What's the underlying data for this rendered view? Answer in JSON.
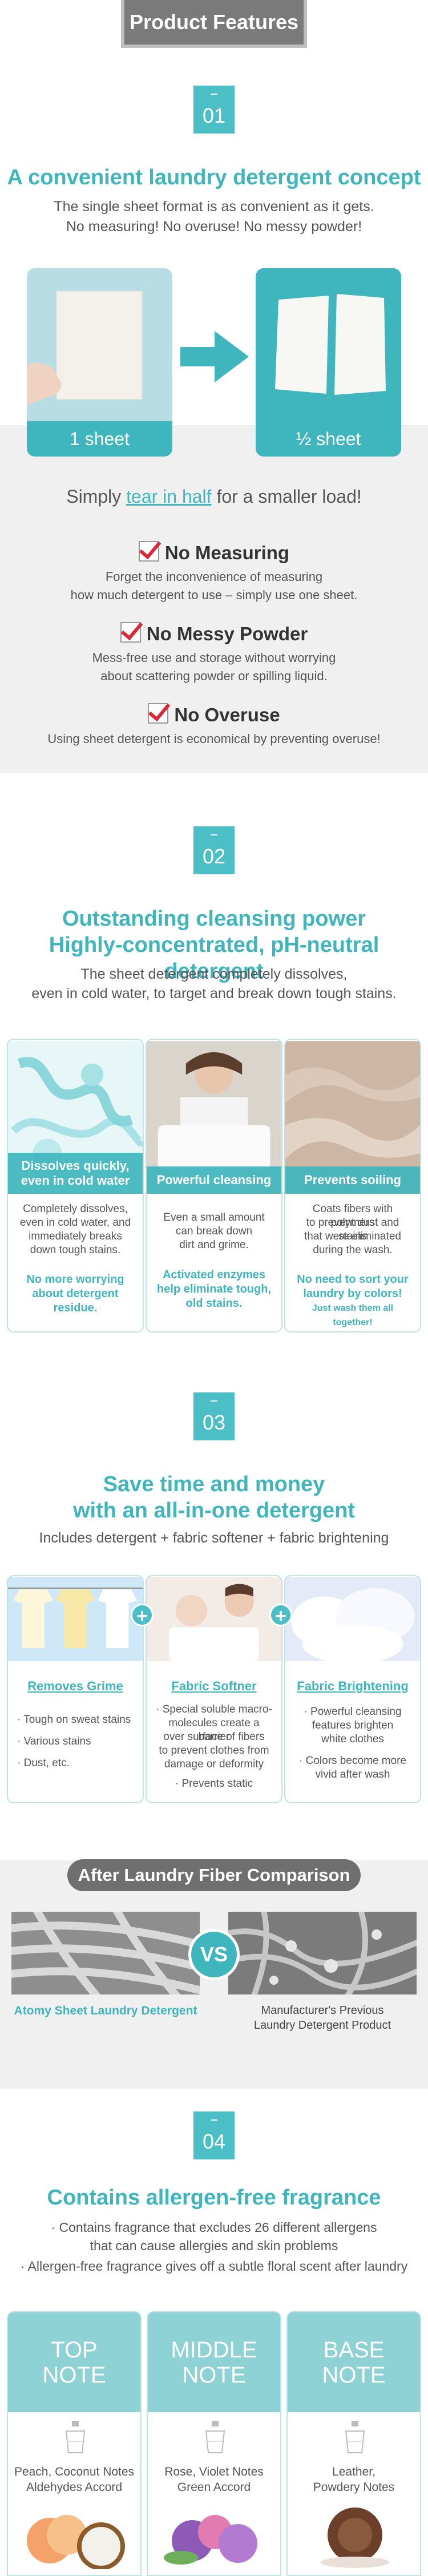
{
  "header": {
    "title": "Product Features"
  },
  "s1": {
    "num": "01",
    "title": "A convenient laundry detergent concept",
    "sub1": "The single sheet format is as convenient as it gets.",
    "sub2": "No measuring! No overuse! No messy powder!",
    "sheet1": "1 sheet",
    "sheet2": "½ sheet",
    "tear_pre": "Simply ",
    "tear_hl": "tear in half",
    "tear_post": " for a smaller load!",
    "features": [
      {
        "title": "No Measuring",
        "d1": "Forget the inconvenience of measuring",
        "d2": "how much detergent to use – simply use one sheet."
      },
      {
        "title": "No Messy Powder",
        "d1": "Mess-free use and storage without worrying",
        "d2": "about scattering powder or spilling liquid."
      },
      {
        "title": "No Overuse",
        "d1": "Using sheet detergent is economical by preventing overuse!",
        "d2": ""
      }
    ]
  },
  "s2": {
    "num": "02",
    "title1": "Outstanding cleansing power",
    "title2": "Highly-concentrated, pH-neutral detergent",
    "sub1": "The sheet detergent completely dissolves,",
    "sub2": "even in cold water, to target and break down tough stains.",
    "cards": [
      {
        "cap": "Dissolves quickly, even in cold water",
        "t1": "Completely dissolves,",
        "t2": "even in cold water, and",
        "t3": "immediately breaks",
        "t4": "down tough stains.",
        "h1": "No more worrying",
        "h2": "about detergent",
        "h3": "residue.",
        "h4": ""
      },
      {
        "cap": "Powerful cleansing",
        "t1": "Even a small amount",
        "t2": "can break down",
        "t3": "dirt and grime.",
        "t4": "",
        "h1": "Activated enzymes",
        "h2": "help eliminate tough,",
        "h3": "old stains.",
        "h4": ""
      },
      {
        "cap": "Prevents soiling",
        "t1": "Coats fibers with polymers",
        "t2": "to prevent dust and stains",
        "t3": "that were eliminated",
        "t4": "during the wash.",
        "h1": "No need to sort your",
        "h2": "laundry by colors!",
        "h3": "Just wash them all together!",
        "h4": ""
      }
    ]
  },
  "s3": {
    "num": "03",
    "title1": "Save time and money",
    "title2": "with an all-in-one detergent",
    "sub": "Includes detergent + fabric softener + fabric brightening",
    "cards": [
      {
        "title": "Removes Grime",
        "items": [
          "· Tough on sweat stains",
          "· Various stains",
          "· Dust, etc."
        ]
      },
      {
        "title": "Fabric Softner",
        "items": [
          "· Special soluble macro-",
          "molecules create a barrier",
          "over surface of fibers",
          "to prevent clothes from",
          "damage or deformity",
          "· Prevents static"
        ]
      },
      {
        "title": "Fabric Brightening",
        "items": [
          "· Powerful cleansing",
          "features brighten",
          "white clothes",
          "· Colors become more",
          "vivid after wash"
        ]
      }
    ]
  },
  "cmp": {
    "title": "After Laundry Fiber Comparison",
    "vs": "VS",
    "left": "Atomy Sheet Laundry Detergent",
    "right1": "Manufacturer's Previous",
    "right2": "Laundry Detergent Product"
  },
  "s4": {
    "num": "04",
    "title": "Contains allergen-free fragrance",
    "l1": "· Contains fragrance that excludes 26 different allergens",
    "l2": "that can cause allergies and skin problems",
    "l3": "· Allergen-free fragrance gives off a subtle floral scent after laundry",
    "notes": [
      {
        "a": "TOP",
        "b": "NOTE",
        "t1": "Peach, Coconut Notes",
        "t2": "Aldehydes Accord"
      },
      {
        "a": "MIDDLE",
        "b": "NOTE",
        "t1": "Rose, Violet Notes",
        "t2": "Green Accord"
      },
      {
        "a": "BASE",
        "b": "NOTE",
        "t1": "Leather,",
        "t2": "Powdery Notes"
      }
    ]
  }
}
